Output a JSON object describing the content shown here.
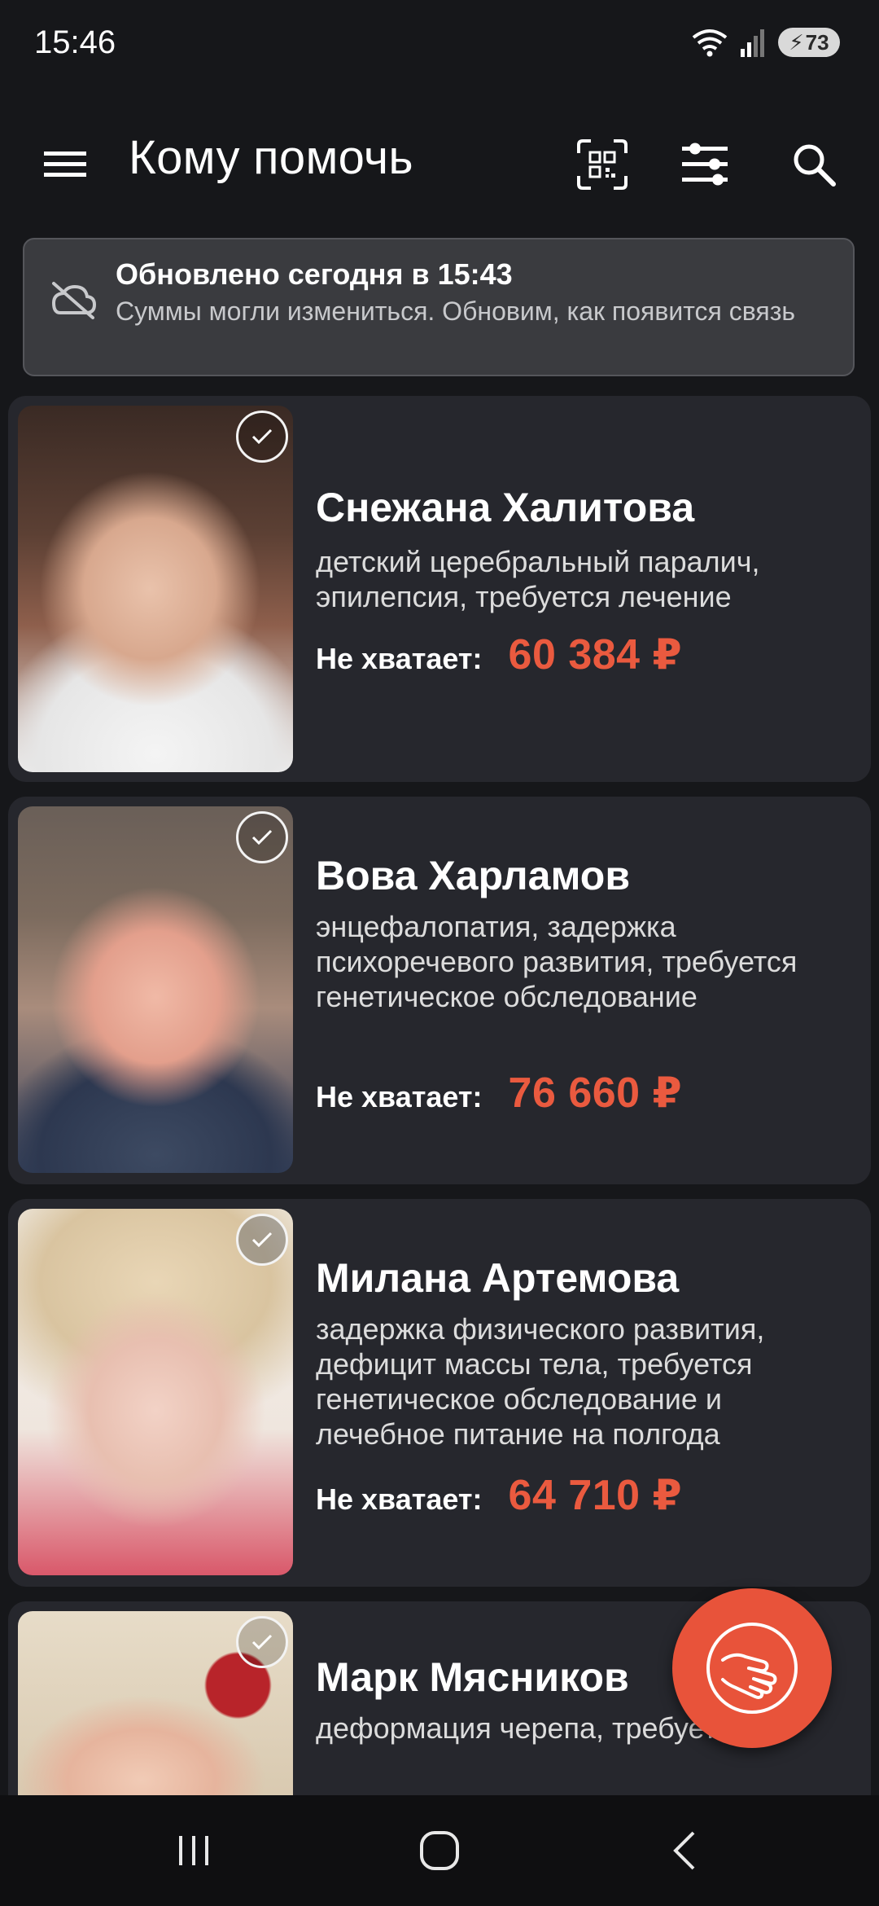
{
  "status_bar": {
    "time": "15:46",
    "battery": "73"
  },
  "header": {
    "title": "Кому помочь"
  },
  "banner": {
    "title": "Обновлено сегодня в 15:43",
    "text": "Суммы могли измениться. Обновим, как появится связь"
  },
  "cards": [
    {
      "name": "Снежана Халитова",
      "diagnosis": "детский церебральный паралич, эпилепсия, требуется лечение",
      "need_label": "Не хватает:",
      "amount": "60 384 ₽"
    },
    {
      "name": "Вова Харламов",
      "diagnosis": "энцефалопатия, задержка психоречевого развития, требуется генетическое обследование",
      "need_label": "Не хватает:",
      "amount": "76 660 ₽"
    },
    {
      "name": "Милана Артемова",
      "diagnosis": "задержка физического развития, дефицит массы тела, требуется генетическое обследование и лечебное питание на полгода",
      "need_label": "Не хватает:",
      "amount": "64 710 ₽"
    },
    {
      "name": "Марк Мясников",
      "diagnosis": "деформация черепа, требуется"
    }
  ],
  "colors": {
    "accent": "#ea5a3f",
    "card_bg": "#26272d",
    "page_bg": "#16171a"
  },
  "icons": {
    "menu": "menu-icon",
    "qr": "qr-scan-icon",
    "filter": "filter-sliders-icon",
    "search": "search-icon",
    "offline": "cloud-off-icon",
    "check": "check-icon",
    "donate": "helping-hand-icon"
  }
}
